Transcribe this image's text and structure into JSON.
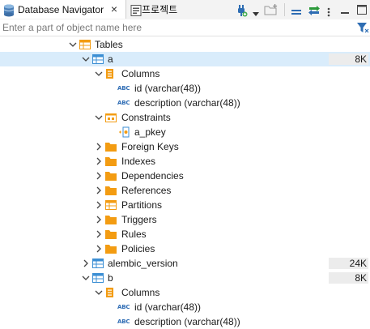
{
  "tabs": [
    {
      "label": "Database Navigator",
      "close": "×"
    },
    {
      "label": "프로젝트"
    }
  ],
  "search": {
    "placeholder": "Enter a part of object name here"
  },
  "tree": {
    "tables": "Tables",
    "table_a": {
      "name": "a",
      "size": "8K"
    },
    "columns_a": "Columns",
    "col_a_id": "id (varchar(48))",
    "col_a_desc": "description (varchar(48))",
    "constraints": "Constraints",
    "pkey": "a_pkey",
    "foreign_keys": "Foreign Keys",
    "indexes": "Indexes",
    "dependencies": "Dependencies",
    "references": "References",
    "partitions": "Partitions",
    "triggers": "Triggers",
    "rules": "Rules",
    "policies": "Policies",
    "alembic": {
      "name": "alembic_version",
      "size": "24K"
    },
    "table_b": {
      "name": "b",
      "size": "8K"
    },
    "columns_b": "Columns",
    "col_b_id": "id (varchar(48))",
    "col_b_desc": "description (varchar(48))"
  },
  "colors": {
    "folder": "#f39c12",
    "table": "#3c8fd4",
    "selection": "#d9ecfb"
  }
}
